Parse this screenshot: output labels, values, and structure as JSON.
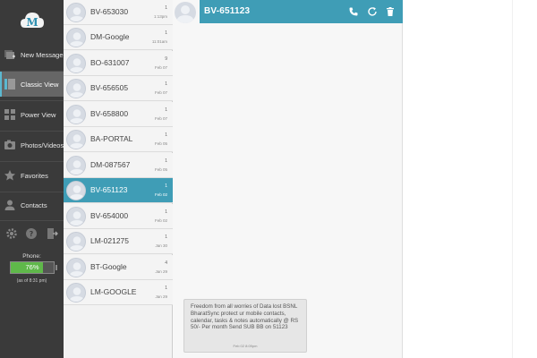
{
  "nav": {
    "logo_letter": "M",
    "items": [
      {
        "label": "New Message",
        "icon": "new-message-icon"
      },
      {
        "label": "Classic View",
        "icon": "classic-view-icon"
      },
      {
        "label": "Power View",
        "icon": "power-view-icon"
      },
      {
        "label": "Photos/Videos",
        "icon": "photos-icon"
      },
      {
        "label": "Favorites",
        "icon": "star-icon"
      },
      {
        "label": "Contacts",
        "icon": "contacts-icon"
      }
    ],
    "active_item": "Classic View",
    "bottom_icons": [
      "gear-icon",
      "help-icon",
      "exit-icon"
    ],
    "phone_label": "Phone:",
    "battery_text": "76%",
    "battery_level": 76,
    "phone_time": "(as of 8:31 pm)"
  },
  "contacts": [
    {
      "name": "BV-653030",
      "count": "1",
      "date": "1:13pm"
    },
    {
      "name": "DM-Google",
      "count": "1",
      "date": "11:01am"
    },
    {
      "name": "BO-631007",
      "count": "9",
      "date": "Feb 07"
    },
    {
      "name": "BV-656505",
      "count": "1",
      "date": "Feb 07"
    },
    {
      "name": "BV-658800",
      "count": "1",
      "date": "Feb 07"
    },
    {
      "name": "BA-PORTAL",
      "count": "1",
      "date": "Feb 05"
    },
    {
      "name": "DM-087567",
      "count": "1",
      "date": "Feb 05"
    },
    {
      "name": "BV-651123",
      "count": "1",
      "date": "Feb 02"
    },
    {
      "name": "BV-654000",
      "count": "1",
      "date": "Feb 02"
    },
    {
      "name": "LM-021275",
      "count": "1",
      "date": "Jan 30"
    },
    {
      "name": "BT-Google",
      "count": "4",
      "date": "Jan 29"
    },
    {
      "name": "LM-GOOGLE",
      "count": "1",
      "date": "Jan 29"
    }
  ],
  "selected_contact": "BV-651123",
  "conversation": {
    "title": "BV-651123",
    "header_icons": [
      "phone-icon",
      "refresh-icon",
      "trash-icon"
    ],
    "message_text": "Freedom from all worries of Data lost BSNL BharatSync protect ur mobile contacts, calendar, tasks & notes automatically @ RS 50/- Per month Send SUB BB on 51123",
    "message_time": "Feb 02 8:09pm"
  },
  "colors": {
    "accent": "#3f9db6",
    "nav_bg": "#3a3a3a",
    "battery": "#5fb84a"
  }
}
